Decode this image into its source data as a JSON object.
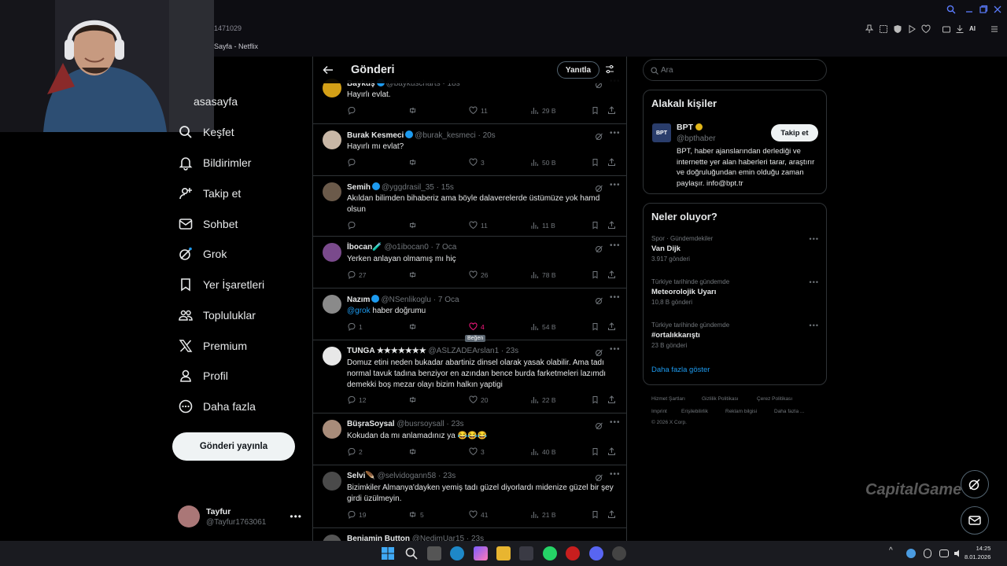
{
  "browser": {
    "url_fragment": "1471029",
    "tab_title": "Sayfa - Netflix",
    "ai_label": "AI"
  },
  "sidebar": {
    "items": [
      {
        "label": "asasayfa",
        "icon": "home-icon"
      },
      {
        "label": "Keşfet",
        "icon": "search-icon"
      },
      {
        "label": "Bildirimler",
        "icon": "bell-icon"
      },
      {
        "label": "Takip et",
        "icon": "person-add-icon"
      },
      {
        "label": "Sohbet",
        "icon": "mail-icon"
      },
      {
        "label": "Grok",
        "icon": "grok-icon"
      },
      {
        "label": "Yer İşaretleri",
        "icon": "bookmark-icon"
      },
      {
        "label": "Topluluklar",
        "icon": "communities-icon"
      },
      {
        "label": "Premium",
        "icon": "x-logo-icon"
      },
      {
        "label": "Profil",
        "icon": "profile-icon"
      },
      {
        "label": "Daha fazla",
        "icon": "more-circle-icon"
      }
    ],
    "post_button": "Gönderi yayınla",
    "user": {
      "name": "Tayfur",
      "handle": "@Tayfur1763061"
    }
  },
  "main": {
    "title": "Gönderi",
    "reply_button": "Yanıtla",
    "tooltip_like": "Beğen",
    "tweets": [
      {
        "name": "Baykuş",
        "handle": "@baykuscharts",
        "time": "18s",
        "verified": true,
        "text": "Hayırlı evlat.",
        "mention": "",
        "replies": "",
        "retweets": "",
        "likes": "11",
        "views": "29 B",
        "avatar_color": "#d4a017"
      },
      {
        "name": "Burak Kesmeci",
        "handle": "@burak_kesmeci",
        "time": "20s",
        "verified": true,
        "text": "Hayırlı mı evlat?",
        "mention": "",
        "replies": "",
        "retweets": "",
        "likes": "3",
        "views": "50 B",
        "avatar_color": "#c8b7a6"
      },
      {
        "name": "Semih",
        "handle": "@yggdrasil_35",
        "time": "15s",
        "verified": true,
        "text": "Akıldan bilimden bihaberiz ama böyle dalaverelerde üstümüze yok hamd olsun",
        "mention": "",
        "replies": "",
        "retweets": "",
        "likes": "11",
        "views": "11 B",
        "avatar_color": "#6b5a4a"
      },
      {
        "name": "İbocan🧪",
        "handle": "@o1ibocan0",
        "time": "7 Oca",
        "verified": false,
        "text": "Yerken anlayan olmamış mı hiç",
        "mention": "",
        "replies": "27",
        "retweets": "",
        "likes": "26",
        "views": "78 B",
        "avatar_color": "#7a4a8c"
      },
      {
        "name": "Nazım",
        "handle": "@NSenlikoglu",
        "time": "7 Oca",
        "verified": true,
        "text": "haber doğrumu",
        "mention": "@grok",
        "replies": "1",
        "retweets": "",
        "likes": "4",
        "views": "54 B",
        "avatar_color": "#8a8a8a"
      },
      {
        "name": "TUNGA ★★★★★★★",
        "handle": "@ASLZADEArslan1",
        "time": "23s",
        "verified": false,
        "text": "Domuz etini neden bukadar abartiniz dinsel olarak yasak olabilir. Ama tadı normal tavuk tadına benziyor en azından bence burda farketmeleri  lazımdı demekki boş mezar olayı bizim halkın yaptigi",
        "mention": "",
        "replies": "12",
        "retweets": "",
        "likes": "20",
        "views": "22 B",
        "avatar_color": "#e8e8e8"
      },
      {
        "name": "BüşraSoysal",
        "handle": "@busrsoysall",
        "time": "23s",
        "verified": false,
        "text": "Kokudan da mı anlamadınız ya 😂😂😂",
        "mention": "",
        "replies": "2",
        "retweets": "",
        "likes": "3",
        "views": "40 B",
        "avatar_color": "#a88c7a"
      },
      {
        "name": "Selvi🪶",
        "handle": "@selvidogann58",
        "time": "23s",
        "verified": false,
        "text": "Bizimkiler Almanya'dayken yemiş tadı güzel diyorlardı midenize güzel bir şey girdi üzülmeyin.",
        "mention": "",
        "replies": "19",
        "retweets": "5",
        "likes": "41",
        "views": "21 B",
        "avatar_color": "#4a4a4a"
      },
      {
        "name": "Benjamin Button",
        "handle": "@NedimUar15",
        "time": "23s",
        "verified": false,
        "text": "",
        "mention": "",
        "replies": "",
        "retweets": "",
        "likes": "",
        "views": "",
        "avatar_color": "#555555"
      }
    ]
  },
  "right": {
    "search_placeholder": "Ara",
    "relevant_title": "Alakalı kişiler",
    "bpt": {
      "logo": "BPT",
      "name": "BPT",
      "handle": "@bpthaber",
      "follow": "Takip et",
      "bio": "BPT, haber ajanslarından derlediği ve internette yer alan haberleri tarar, araştırır ve doğruluğundan emin olduğu zaman paylaşır. info@bpt.tr"
    },
    "trends_title": "Neler oluyor?",
    "trends": [
      {
        "context": "Spor · Gündemdekiler",
        "title": "Van Dijk",
        "posts": "3.917 gönderi"
      },
      {
        "context": "Türkiye tarihinde gündemde",
        "title": "Meteorolojik Uyarı",
        "posts": "10,8 B gönderi"
      },
      {
        "context": "Türkiye tarihinde gündemde",
        "title": "#ortalıkkarıştı",
        "posts": "23 B gönderi"
      }
    ],
    "show_more": "Daha fazla göster",
    "footer_links": [
      "Hizmet Şartları",
      "Gizlilik Politikası",
      "Çerez Politikası",
      "Imprint",
      "Erişilebilirlik",
      "Reklam bilgisi",
      "Daha fazla ..."
    ],
    "copyright": "© 2026 X Corp."
  },
  "watermark": "CapitalGame",
  "taskbar": {
    "time": "14:25",
    "date": "8.01.2026"
  },
  "colors": {
    "accent": "#1d9bf0",
    "like_active": "#f91880",
    "border": "#2f3336",
    "muted": "#71767b"
  }
}
